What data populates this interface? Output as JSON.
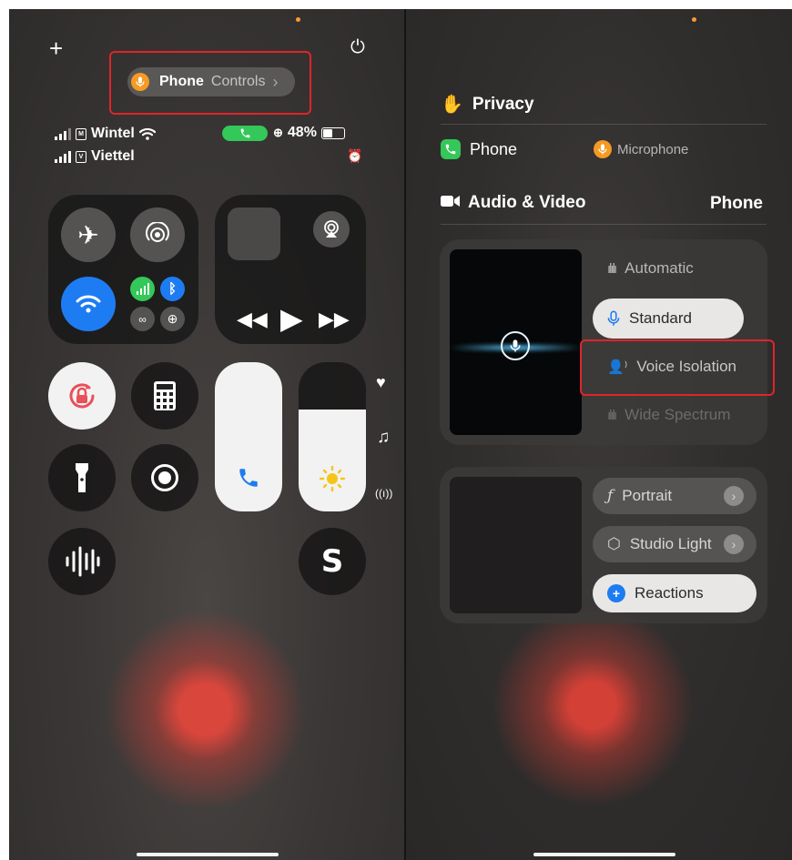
{
  "left": {
    "top_bar": {
      "add_glyph": "+",
      "power_glyph": "⏻"
    },
    "app_pill": {
      "app": "Phone",
      "label": "Controls",
      "chevron": "›"
    },
    "status": {
      "carrier1": "Wintel",
      "sim1": "M",
      "carrier2": "Viettel",
      "sim2": "V",
      "battery": "48%",
      "battery_level": 0.48
    },
    "brightness_level": 0.68
  },
  "right": {
    "privacy": {
      "title": "Privacy",
      "app": "Phone",
      "sensor": "Microphone"
    },
    "audio_video": {
      "title": "Audio & Video",
      "app": "Phone"
    },
    "mic_modes": [
      "Automatic",
      "Standard",
      "Voice Isolation",
      "Wide Spectrum"
    ],
    "selected_mode": "Standard",
    "video_effects": [
      "Portrait",
      "Studio Light",
      "Reactions"
    ]
  },
  "colors": {
    "accent_blue": "#1e7cf2",
    "green": "#34c759",
    "orange": "#f59a23",
    "highlight_red": "#e0242a"
  }
}
